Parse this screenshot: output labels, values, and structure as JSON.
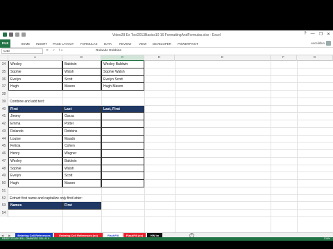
{
  "window": {
    "title": "Video28 Ex Tool2013Basics10 16 FormattingAndFormulas.xlsx - Excel",
    "controls": [
      "?",
      "—",
      "❐",
      "✕"
    ]
  },
  "colors": {
    "excel_green": "#217346",
    "header_navy": "#1f3864",
    "tab_red": "#e8212d",
    "tab_blue": "#1a3cc8"
  },
  "ribbon": {
    "file_label": "FILE",
    "tabs": [
      "HOME",
      "INSERT",
      "PAGE LAYOUT",
      "FORMULAS",
      "DATA",
      "REVIEW",
      "VIEW",
      "DEVELOPER",
      "POWERPIVOT"
    ],
    "user": "excelisfun"
  },
  "formula_bar": {
    "name_box": "C40",
    "fx_label": "✕ ✓ fx",
    "content": "Rolando Robbins"
  },
  "columns": [
    "A",
    "B",
    "C",
    "D",
    "E",
    "F",
    "G"
  ],
  "rows": [
    {
      "n": "34",
      "a": "Wesley",
      "b": "Baldwin",
      "c": "Wesley Baldwin"
    },
    {
      "n": "35",
      "a": "Sophie",
      "b": "Walsh",
      "c": "Sophie Walsh"
    },
    {
      "n": "36",
      "a": "Evelyn",
      "b": "Scott",
      "c": "Evelyn Scott"
    },
    {
      "n": "37",
      "a": "Hugh",
      "b": "Mason",
      "c": "Hugh Mason"
    },
    {
      "n": "38",
      "a": "",
      "b": "",
      "c": ""
    },
    {
      "n": "39",
      "a": "Combine and add text:",
      "b": "",
      "c": ""
    },
    {
      "n": "40",
      "a": "First",
      "b": "Last",
      "c": "Last, First",
      "header": true
    },
    {
      "n": "41",
      "a": "Jimmy",
      "b": "Garza",
      "c": ""
    },
    {
      "n": "42",
      "a": "Emma",
      "b": "Potter",
      "c": ""
    },
    {
      "n": "43",
      "a": "Rolando",
      "b": "Robbins",
      "c": ""
    },
    {
      "n": "44",
      "a": "Louise",
      "b": "Maado",
      "c": ""
    },
    {
      "n": "45",
      "a": "Felicia",
      "b": "Cohen",
      "c": ""
    },
    {
      "n": "46",
      "a": "Henry",
      "b": "Wagner",
      "c": ""
    },
    {
      "n": "47",
      "a": "Wesley",
      "b": "Baldwin",
      "c": ""
    },
    {
      "n": "48",
      "a": "Sophie",
      "b": "Walsh",
      "c": ""
    },
    {
      "n": "49",
      "a": "Evelyn",
      "b": "Scott",
      "c": ""
    },
    {
      "n": "50",
      "a": "Hugh",
      "b": "Mason",
      "c": ""
    },
    {
      "n": "51",
      "a": "",
      "b": "",
      "c": ""
    },
    {
      "n": "52",
      "a": "Extract first name and capitalize only first letter:",
      "b": "",
      "c": ""
    },
    {
      "n": "53",
      "a": "Names",
      "b": "First",
      "c": "",
      "header": true
    },
    {
      "n": "54",
      "a": "",
      "b": "",
      "c": ""
    }
  ],
  "sheet_tabs": [
    {
      "label": "Entering Cell References",
      "color": "#1a3cc8"
    },
    {
      "label": "Entering Cell References (ex)",
      "color": "#e8212d"
    },
    {
      "label": "FlashFill",
      "color": "#1a3cc8"
    },
    {
      "label": "FlashFill (ex)",
      "color": "#e8212d"
    },
    {
      "label": "HW Im",
      "color": "#111111"
    }
  ],
  "status": {
    "text": "READY    FLASH FILL CHANGED CELLS: 9",
    "zoom": "136%"
  }
}
